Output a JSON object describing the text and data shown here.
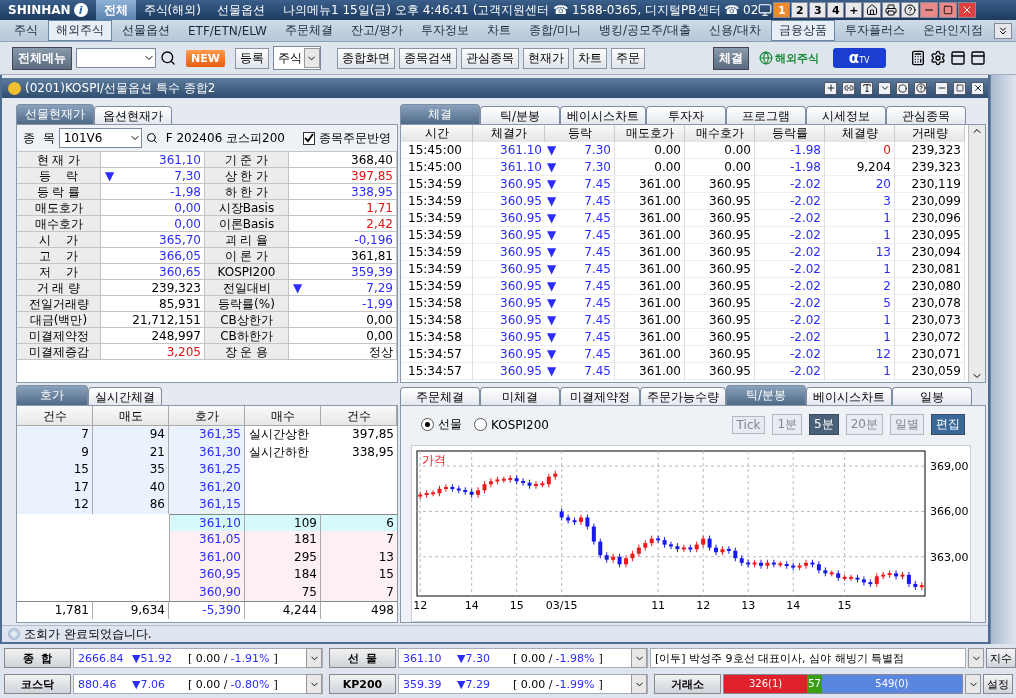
{
  "app_bar": {
    "logo": "SHINHAN",
    "logo_mark": "i",
    "tabs": [
      {
        "label": "전체",
        "selected": true
      },
      {
        "label": "주식(해외)",
        "selected": false
      },
      {
        "label": "선물옵션",
        "selected": false
      }
    ],
    "info": "나의메뉴1 15일(금) 오후 4:46:41 (고객지원센터 ☎ 1588-0365, 디지털PB센터 ☎ 02",
    "screens": [
      {
        "label": "1",
        "selected": true
      },
      {
        "label": "2",
        "selected": false
      },
      {
        "label": "3",
        "selected": false
      },
      {
        "label": "4",
        "selected": false
      },
      {
        "label": "+",
        "selected": false
      }
    ]
  },
  "menu": [
    {
      "label": "주식",
      "selected": false
    },
    {
      "label": "해외주식",
      "selected": true
    },
    {
      "label": "선물옵션",
      "selected": false
    },
    {
      "label": "ETF/ETN/ELW",
      "selected": false
    },
    {
      "label": "주문체결",
      "selected": false
    },
    {
      "label": "잔고/평가",
      "selected": false
    },
    {
      "label": "투자정보",
      "selected": false
    },
    {
      "label": "차트",
      "selected": false
    },
    {
      "label": "종합/미니",
      "selected": false
    },
    {
      "label": "뱅킹/공모주/대출",
      "selected": false
    },
    {
      "label": "신용/대차",
      "selected": false
    },
    {
      "label": "금융상품",
      "selected": true
    },
    {
      "label": "투자플러스",
      "selected": false
    },
    {
      "label": "온라인지점",
      "selected": false
    }
  ],
  "toolbar": {
    "all_menu": "전체메뉴",
    "new_badge": "NEW",
    "register": "등록",
    "market_select": "주식",
    "shortcuts": [
      "종합화면",
      "종목검색",
      "관심종목",
      "현재가",
      "차트",
      "주문"
    ],
    "fill_button": "체결",
    "overseas_logo": "해외주식",
    "tv_logo": {
      "mark": "α",
      "label": "TV"
    }
  },
  "window": {
    "title": "(0201)KOSPI/선물옵션 특수 종합2",
    "status": "조회가 완료되었습니다."
  },
  "quote": {
    "tabs": [
      {
        "label": "선물현재가",
        "selected": true
      },
      {
        "label": "옵션현재가",
        "selected": false
      }
    ],
    "code_label": "종  목",
    "code": "101V6",
    "name": "F 202406 코스피200",
    "order_link": {
      "label": "종목주문반영",
      "checked": true
    },
    "rows": [
      {
        "left": {
          "label": "현 재 가",
          "value": "361,10",
          "color": "#2b2bff"
        },
        "right": {
          "label": "기 준 가",
          "value": "368,40"
        }
      },
      {
        "left": {
          "label": "등    락",
          "value": "7,30",
          "color": "#2b2bff",
          "arrow": "▼"
        },
        "right": {
          "label": "상 한 가",
          "value": "397,85",
          "color": "#e01010"
        }
      },
      {
        "left": {
          "label": "등 락 률",
          "value": "-1,98",
          "color": "#2b2bff"
        },
        "right": {
          "label": "하 한 가",
          "value": "338,95",
          "color": "#2b2bff"
        }
      },
      {
        "left": {
          "label": "매도호가",
          "value": "0,00",
          "color": "#2b2bff"
        },
        "right": {
          "label": "시장Basis",
          "value": "1,71",
          "color": "#e01010"
        }
      },
      {
        "left": {
          "label": "매수호가",
          "value": "0,00",
          "color": "#2b2bff"
        },
        "right": {
          "label": "이론Basis",
          "value": "2,42",
          "color": "#e01010"
        }
      },
      {
        "left": {
          "label": "시    가",
          "value": "365,70",
          "color": "#2b2bff"
        },
        "right": {
          "label": "괴 리 율",
          "value": "-0,196",
          "color": "#2b2bff"
        }
      },
      {
        "left": {
          "label": "고    가",
          "value": "366,05",
          "color": "#2b2bff"
        },
        "right": {
          "label": "이 론 가",
          "value": "361,81"
        }
      },
      {
        "left": {
          "label": "저    가",
          "value": "360,65",
          "color": "#2b2bff"
        },
        "right": {
          "label": "KOSPI200",
          "value": "359,39",
          "color": "#2b2bff"
        }
      },
      {
        "left": {
          "label": "거 래 량",
          "value": "239,323"
        },
        "right": {
          "label": "전일대비",
          "value": "7,29",
          "color": "#2b2bff",
          "arrow": "▼"
        }
      },
      {
        "left": {
          "label": "전일거래량",
          "value": "85,931"
        },
        "right": {
          "label": "등락률(%)",
          "value": "-1,99",
          "color": "#2b2bff"
        }
      },
      {
        "left": {
          "label": "대금(백만)",
          "value": "21,712,151"
        },
        "right": {
          "label": "CB상한가",
          "value": "0,00"
        }
      },
      {
        "left": {
          "label": "미결제약정",
          "value": "248,997"
        },
        "right": {
          "label": "CB하한가",
          "value": "0,00"
        }
      },
      {
        "left": {
          "label": "미결제증감",
          "value": "3,205",
          "color": "#e01010"
        },
        "right": {
          "label": "장 운 용",
          "value": "정상"
        }
      }
    ]
  },
  "order_book": {
    "tabs": [
      {
        "label": "호가",
        "selected": true
      },
      {
        "label": "실시간체결",
        "selected": false
      }
    ],
    "columns": [
      "건수",
      "매도",
      "호가",
      "매수",
      "건수"
    ],
    "asks": [
      {
        "count": "7",
        "qty": "94",
        "price": "361,35"
      },
      {
        "count": "9",
        "qty": "21",
        "price": "361,30"
      },
      {
        "count": "15",
        "qty": "35",
        "price": "361,25"
      },
      {
        "count": "17",
        "qty": "40",
        "price": "361,20"
      },
      {
        "count": "12",
        "qty": "86",
        "price": "361,15"
      }
    ],
    "limits": [
      {
        "label": "실시간상한",
        "value": "397,85"
      },
      {
        "label": "실시간하한",
        "value": "338,95"
      }
    ],
    "bids": [
      {
        "price": "361,10",
        "qty": "109",
        "count": "6",
        "current": true
      },
      {
        "price": "361,05",
        "qty": "181",
        "count": "7",
        "current": false
      },
      {
        "price": "361,00",
        "qty": "295",
        "count": "13",
        "current": false
      },
      {
        "price": "360,95",
        "qty": "184",
        "count": "15",
        "current": false
      },
      {
        "price": "360,90",
        "qty": "75",
        "count": "7",
        "current": false
      }
    ],
    "totals": [
      "1,781",
      "9,634",
      "-5,390",
      "4,244",
      "498"
    ]
  },
  "trades": {
    "tabs": [
      {
        "label": "체결",
        "selected": true
      },
      {
        "label": "틱/분봉",
        "selected": false
      },
      {
        "label": "베이시스차트",
        "selected": false
      },
      {
        "label": "투자자",
        "selected": false
      },
      {
        "label": "프로그램",
        "selected": false
      },
      {
        "label": "시세정보",
        "selected": false
      },
      {
        "label": "관심종목",
        "selected": false
      }
    ],
    "columns": [
      "시간",
      "체결가",
      "등락",
      "매도호가",
      "매수호가",
      "등락률",
      "체결량",
      "거래량"
    ],
    "rows": [
      {
        "time": "15:45:00",
        "price": "361.10",
        "arrow": "▼",
        "change": "7.30",
        "ask": "0.00",
        "bid": "0.00",
        "rate": "-1.98",
        "volume": {
          "text": "0",
          "color": "#e01010"
        },
        "total": "239,323"
      },
      {
        "time": "15:45:00",
        "price": "361.10",
        "arrow": "▼",
        "change": "7.30",
        "ask": "0.00",
        "bid": "0.00",
        "rate": "-1.98",
        "volume": {
          "text": "9,204"
        },
        "total": "239,323"
      },
      {
        "time": "15:34:59",
        "price": "360.95",
        "arrow": "▼",
        "change": "7.45",
        "ask": "361.00",
        "bid": "360.95",
        "rate": "-2.02",
        "volume": {
          "text": "20",
          "color": "#2b2bff"
        },
        "total": "230,119"
      },
      {
        "time": "15:34:59",
        "price": "360.95",
        "arrow": "▼",
        "change": "7.45",
        "ask": "361.00",
        "bid": "360.95",
        "rate": "-2.02",
        "volume": {
          "text": "3",
          "color": "#2b2bff"
        },
        "total": "230,099"
      },
      {
        "time": "15:34:59",
        "price": "360.95",
        "arrow": "▼",
        "change": "7.45",
        "ask": "361.00",
        "bid": "360.95",
        "rate": "-2.02",
        "volume": {
          "text": "1",
          "color": "#2b2bff"
        },
        "total": "230,096"
      },
      {
        "time": "15:34:59",
        "price": "360.95",
        "arrow": "▼",
        "change": "7.45",
        "ask": "361.00",
        "bid": "360.95",
        "rate": "-2.02",
        "volume": {
          "text": "1",
          "color": "#2b2bff"
        },
        "total": "230,095"
      },
      {
        "time": "15:34:59",
        "price": "360.95",
        "arrow": "▼",
        "change": "7.45",
        "ask": "361.00",
        "bid": "360.95",
        "rate": "-2.02",
        "volume": {
          "text": "13",
          "color": "#2b2bff"
        },
        "total": "230,094"
      },
      {
        "time": "15:34:59",
        "price": "360.95",
        "arrow": "▼",
        "change": "7.45",
        "ask": "361.00",
        "bid": "360.95",
        "rate": "-2.02",
        "volume": {
          "text": "1",
          "color": "#2b2bff"
        },
        "total": "230,081"
      },
      {
        "time": "15:34:59",
        "price": "360.95",
        "arrow": "▼",
        "change": "7.45",
        "ask": "361.00",
        "bid": "360.95",
        "rate": "-2.02",
        "volume": {
          "text": "2",
          "color": "#2b2bff"
        },
        "total": "230,080"
      },
      {
        "time": "15:34:58",
        "price": "360.95",
        "arrow": "▼",
        "change": "7.45",
        "ask": "361.00",
        "bid": "360.95",
        "rate": "-2.02",
        "volume": {
          "text": "5",
          "color": "#2b2bff"
        },
        "total": "230,078"
      },
      {
        "time": "15:34:58",
        "price": "360.95",
        "arrow": "▼",
        "change": "7.45",
        "ask": "361.00",
        "bid": "360.95",
        "rate": "-2.02",
        "volume": {
          "text": "1",
          "color": "#2b2bff"
        },
        "total": "230,073"
      },
      {
        "time": "15:34:58",
        "price": "360.95",
        "arrow": "▼",
        "change": "7.45",
        "ask": "361.00",
        "bid": "360.95",
        "rate": "-2.02",
        "volume": {
          "text": "1",
          "color": "#2b2bff"
        },
        "total": "230,072"
      },
      {
        "time": "15:34:57",
        "price": "360.95",
        "arrow": "▼",
        "change": "7.45",
        "ask": "361.00",
        "bid": "360.95",
        "rate": "-2.02",
        "volume": {
          "text": "12",
          "color": "#2b2bff"
        },
        "total": "230,071"
      },
      {
        "time": "15:34:57",
        "price": "360.95",
        "arrow": "▼",
        "change": "7.45",
        "ask": "361.00",
        "bid": "360.95",
        "rate": "-2.02",
        "volume": {
          "text": "1",
          "color": "#2b2bff"
        },
        "total": "230,059"
      }
    ]
  },
  "chart_panel": {
    "tabs": [
      {
        "label": "주문체결",
        "selected": false
      },
      {
        "label": "미체결",
        "selected": false
      },
      {
        "label": "미결제약정",
        "selected": false
      },
      {
        "label": "주문가능수량",
        "selected": false
      },
      {
        "label": "틱/분봉",
        "selected": true
      },
      {
        "label": "베이시스차트",
        "selected": false
      },
      {
        "label": "일봉",
        "selected": false
      }
    ],
    "sources": [
      {
        "label": "선물",
        "selected": true
      },
      {
        "label": "KOSPI200",
        "selected": false
      }
    ],
    "periods": [
      {
        "label": "Tick",
        "selected": false,
        "disabled": true
      },
      {
        "label": "1분",
        "selected": false,
        "disabled": true
      },
      {
        "label": "5분",
        "selected": true,
        "disabled": false
      },
      {
        "label": "20분",
        "selected": false,
        "disabled": true
      },
      {
        "label": "일별",
        "selected": false,
        "disabled": true
      }
    ],
    "edit": "편집",
    "chart_data": {
      "type": "candlestick",
      "grid": true,
      "ylabel": "가격",
      "ylim": [
        360.4,
        370
      ],
      "yticks": [
        {
          "value": 369,
          "label": "369,00"
        },
        {
          "value": 366,
          "label": "366,00"
        },
        {
          "value": 363,
          "label": "363,00"
        }
      ],
      "categories": [
        "12",
        null,
        null,
        null,
        null,
        null,
        null,
        null,
        "14",
        null,
        null,
        null,
        null,
        null,
        null,
        "15",
        null,
        null,
        null,
        null,
        null,
        null,
        "03/15",
        null,
        null,
        null,
        null,
        null,
        null,
        null,
        null,
        null,
        null,
        null,
        null,
        null,
        null,
        "11",
        null,
        null,
        null,
        null,
        null,
        null,
        "12",
        null,
        null,
        null,
        null,
        null,
        null,
        "13",
        null,
        null,
        null,
        null,
        null,
        null,
        "14",
        null,
        null,
        null,
        null,
        null,
        null,
        null,
        "15",
        null,
        null,
        null,
        null,
        null,
        null,
        null,
        null,
        null,
        null,
        null,
        null
      ],
      "ohlc": [
        [
          367.0,
          367.3,
          366.8,
          367.1
        ],
        [
          367.1,
          367.4,
          366.9,
          367.2
        ],
        [
          367.2,
          367.4,
          367.0,
          367.2
        ],
        [
          367.2,
          367.7,
          367.0,
          367.5
        ],
        [
          367.5,
          367.8,
          367.3,
          367.6
        ],
        [
          367.6,
          367.8,
          367.3,
          367.5
        ],
        [
          367.5,
          367.7,
          367.2,
          367.4
        ],
        [
          367.4,
          367.6,
          367.1,
          367.3
        ],
        [
          367.3,
          367.5,
          366.9,
          367.1
        ],
        [
          367.1,
          367.6,
          366.9,
          367.4
        ],
        [
          367.4,
          368.0,
          367.2,
          367.8
        ],
        [
          367.8,
          368.2,
          367.6,
          368.0
        ],
        [
          368.0,
          368.3,
          367.8,
          368.1
        ],
        [
          368.1,
          368.3,
          367.9,
          368.1
        ],
        [
          368.1,
          368.4,
          367.9,
          368.2
        ],
        [
          368.2,
          368.4,
          367.8,
          368.0
        ],
        [
          368.0,
          368.2,
          367.7,
          367.9
        ],
        [
          367.9,
          368.1,
          367.5,
          367.7
        ],
        [
          367.7,
          368.0,
          367.5,
          367.8
        ],
        [
          367.8,
          368.0,
          367.6,
          367.8
        ],
        [
          367.8,
          368.5,
          367.6,
          368.3
        ],
        [
          368.3,
          368.7,
          368.1,
          368.5
        ],
        [
          366.0,
          366.2,
          365.4,
          365.6
        ],
        [
          365.6,
          365.8,
          365.2,
          365.4
        ],
        [
          365.4,
          365.6,
          365.1,
          365.3
        ],
        [
          365.3,
          365.8,
          365.1,
          365.6
        ],
        [
          365.6,
          365.8,
          364.8,
          365.0
        ],
        [
          365.0,
          365.2,
          363.8,
          364.0
        ],
        [
          364.0,
          364.2,
          362.9,
          363.1
        ],
        [
          363.1,
          363.3,
          362.6,
          362.8
        ],
        [
          362.8,
          363.2,
          362.6,
          363.0
        ],
        [
          363.0,
          363.2,
          362.3,
          362.5
        ],
        [
          362.5,
          363.1,
          362.3,
          362.9
        ],
        [
          362.9,
          363.4,
          362.7,
          363.2
        ],
        [
          363.2,
          363.8,
          363.0,
          363.6
        ],
        [
          363.6,
          364.1,
          363.4,
          363.9
        ],
        [
          363.9,
          364.4,
          363.7,
          364.2
        ],
        [
          364.2,
          364.4,
          363.9,
          364.1
        ],
        [
          364.1,
          364.3,
          363.6,
          363.8
        ],
        [
          363.8,
          364.0,
          363.5,
          363.7
        ],
        [
          363.7,
          363.9,
          363.3,
          363.5
        ],
        [
          363.5,
          363.8,
          363.3,
          363.6
        ],
        [
          363.6,
          363.8,
          363.3,
          363.5
        ],
        [
          363.5,
          364.0,
          363.3,
          363.8
        ],
        [
          363.8,
          364.4,
          363.6,
          364.2
        ],
        [
          364.2,
          364.4,
          363.4,
          363.6
        ],
        [
          363.6,
          363.8,
          363.1,
          363.3
        ],
        [
          363.3,
          363.7,
          363.1,
          363.5
        ],
        [
          363.5,
          363.7,
          363.2,
          363.4
        ],
        [
          363.4,
          363.6,
          362.7,
          362.9
        ],
        [
          362.9,
          363.1,
          362.4,
          362.6
        ],
        [
          362.6,
          362.8,
          362.3,
          362.5
        ],
        [
          362.5,
          362.8,
          362.3,
          362.6
        ],
        [
          362.6,
          362.8,
          362.2,
          362.4
        ],
        [
          362.4,
          362.8,
          362.2,
          362.6
        ],
        [
          362.6,
          362.8,
          362.3,
          362.5
        ],
        [
          362.5,
          362.7,
          362.3,
          362.5
        ],
        [
          362.5,
          362.7,
          362.2,
          362.4
        ],
        [
          362.4,
          362.6,
          362.1,
          362.3
        ],
        [
          362.3,
          362.6,
          362.1,
          362.4
        ],
        [
          362.4,
          362.8,
          362.2,
          362.6
        ],
        [
          362.6,
          362.8,
          362.3,
          362.5
        ],
        [
          362.5,
          362.7,
          361.9,
          362.1
        ],
        [
          362.1,
          362.3,
          361.7,
          361.9
        ],
        [
          361.9,
          362.1,
          361.7,
          361.9
        ],
        [
          361.9,
          362.1,
          361.4,
          361.6
        ],
        [
          361.6,
          361.8,
          361.4,
          361.6
        ],
        [
          361.6,
          361.8,
          361.4,
          361.6
        ],
        [
          361.6,
          361.8,
          361.3,
          361.5
        ],
        [
          361.5,
          361.7,
          361.1,
          361.3
        ],
        [
          361.3,
          361.5,
          361.0,
          361.2
        ],
        [
          361.2,
          361.9,
          361.0,
          361.7
        ],
        [
          361.7,
          362.0,
          361.5,
          361.8
        ],
        [
          361.8,
          362.1,
          361.6,
          361.9
        ],
        [
          361.9,
          362.1,
          361.5,
          361.7
        ],
        [
          361.7,
          362.0,
          361.5,
          361.8
        ],
        [
          361.8,
          362.0,
          361.0,
          361.2
        ],
        [
          361.2,
          361.4,
          360.8,
          361.0
        ],
        [
          361.0,
          361.3,
          360.8,
          361.1
        ]
      ]
    }
  },
  "tickers": [
    [
      {
        "kind": "index",
        "label": "종  합",
        "value": "2666.84",
        "change": "▼51.92",
        "open": "[ 0.00 /",
        "rate": "-1.91%",
        "close": "]"
      },
      {
        "kind": "index",
        "label": "선  물",
        "value": "361.10",
        "change": "▼7.30",
        "open": "[ 0.00 /",
        "rate": "-1.98%",
        "close": "]"
      },
      {
        "kind": "news",
        "text": "[이투] 박성주 9호선 대표이사, 심야 해빙기 특별점",
        "button": "지수"
      }
    ],
    [
      {
        "kind": "index",
        "label": "코스닥",
        "value": "880.46",
        "change": "▼7.06",
        "open": "[ 0.00 /",
        "rate": "-0.80%",
        "close": "]"
      },
      {
        "kind": "index",
        "label": "KP200",
        "value": "359.39",
        "change": "▼7.29",
        "open": "[ 0.00 /",
        "rate": "-1.99%",
        "close": "]"
      },
      {
        "kind": "breadth",
        "label": "거래소",
        "segments": [
          {
            "text": "326(1)",
            "color": "#e0202a"
          },
          {
            "text": "57",
            "color": "#3aa012"
          },
          {
            "text": "549(0)",
            "color": "#5a86e0"
          }
        ],
        "button": "설정"
      }
    ]
  ]
}
